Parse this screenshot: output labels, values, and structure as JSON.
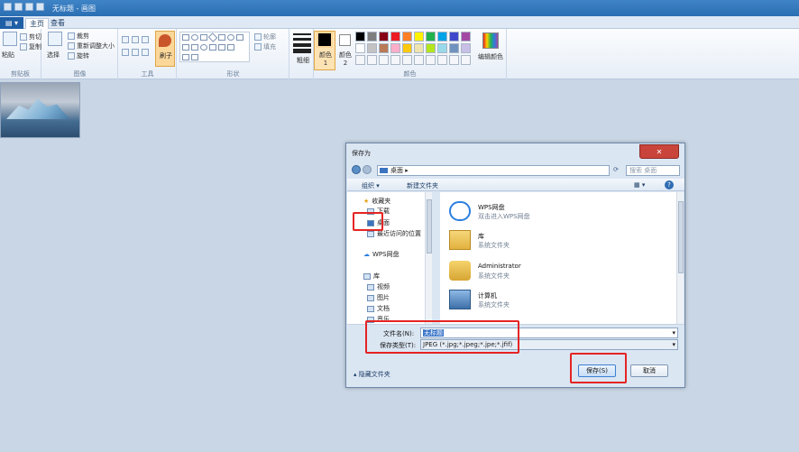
{
  "window": {
    "title": "无标题 - 画图"
  },
  "ribbon": {
    "file_label": "▤ ▾",
    "tabs": [
      "主页",
      "查看"
    ],
    "clipboard": {
      "paste": "粘贴",
      "cut": "剪切",
      "copy": "复制",
      "label": "剪贴板"
    },
    "image": {
      "select": "选择",
      "crop": "裁剪",
      "resize": "重新调整大小",
      "rotate": "旋转",
      "label": "图像"
    },
    "tools": {
      "label": "工具",
      "brush": "刷子"
    },
    "shapes": {
      "outline": "轮廓",
      "fill": "填充",
      "label": "形状"
    },
    "size": {
      "label": "粗细"
    },
    "colors": {
      "color1": "颜色 1",
      "color2": "颜色 2",
      "edit": "编辑颜色",
      "label": "颜色",
      "row1": [
        "#000000",
        "#7f7f7f",
        "#880015",
        "#ed1c24",
        "#ff7f27",
        "#fff200",
        "#22b14c",
        "#00a2e8",
        "#3f48cc",
        "#a349a4"
      ],
      "row2": [
        "#ffffff",
        "#c3c3c3",
        "#b97a57",
        "#ffaec9",
        "#ffc90e",
        "#efe4b0",
        "#b5e61d",
        "#99d9ea",
        "#7092be",
        "#c8bfe7"
      ]
    }
  },
  "dialog": {
    "title": "保存为",
    "close": "✕",
    "path": "桌面",
    "search_placeholder": "搜索 桌面",
    "organize": "组织 ▾",
    "new_folder": "新建文件夹",
    "help": "?",
    "nav": {
      "favorites": "收藏夹",
      "downloads": "下载",
      "desktop": "桌面",
      "recent": "最近访问的位置",
      "wps": "WPS网盘",
      "library": "库",
      "video": "视频",
      "pictures": "图片",
      "documents": "文档",
      "music": "音乐"
    },
    "files": [
      {
        "name": "WPS网盘",
        "desc": "双击进入WPS网盘"
      },
      {
        "name": "库",
        "desc": "系统文件夹"
      },
      {
        "name": "Administrator",
        "desc": "系统文件夹"
      },
      {
        "name": "计算机",
        "desc": "系统文件夹"
      }
    ],
    "filename_label": "文件名(N):",
    "filename_value": "无标题",
    "filetype_label": "保存类型(T):",
    "filetype_value": "JPEG (*.jpg;*.jpeg;*.jpe;*.jfif)",
    "hide_folders": "▴ 隐藏文件夹",
    "save": "保存(S)",
    "cancel": "取消"
  }
}
